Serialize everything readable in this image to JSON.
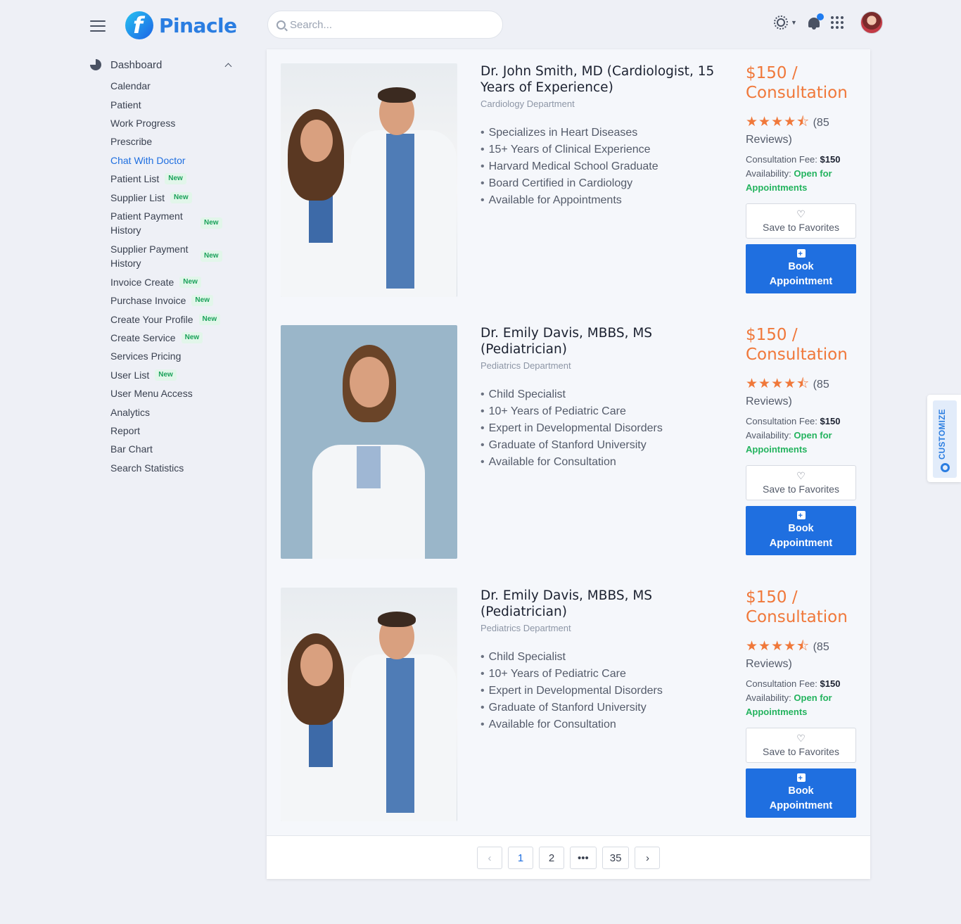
{
  "header": {
    "brand": "Pinacle",
    "search_placeholder": "Search...",
    "icons": [
      "menu-icon",
      "sun-icon",
      "bell-icon",
      "apps-grid-icon",
      "avatar"
    ]
  },
  "sidebar": {
    "section": "Dashboard",
    "items": [
      {
        "label": "Calendar",
        "badge": ""
      },
      {
        "label": "Patient",
        "badge": ""
      },
      {
        "label": "Work Progress",
        "badge": ""
      },
      {
        "label": "Prescribe",
        "badge": ""
      },
      {
        "label": "Chat With Doctor",
        "badge": "",
        "active": true
      },
      {
        "label": "Patient List",
        "badge": "New"
      },
      {
        "label": "Supplier List",
        "badge": "New"
      },
      {
        "label": "Patient Payment History",
        "badge": "New"
      },
      {
        "label": "Supplier Payment History",
        "badge": "New"
      },
      {
        "label": "Invoice Create",
        "badge": "New"
      },
      {
        "label": "Purchase Invoice",
        "badge": "New"
      },
      {
        "label": "Create Your Profile",
        "badge": "New"
      },
      {
        "label": "Create Service",
        "badge": "New"
      },
      {
        "label": "Services Pricing",
        "badge": ""
      },
      {
        "label": "User List",
        "badge": "New"
      },
      {
        "label": "User Menu Access",
        "badge": ""
      },
      {
        "label": "Analytics",
        "badge": ""
      },
      {
        "label": "Report",
        "badge": ""
      },
      {
        "label": "Bar Chart",
        "badge": ""
      },
      {
        "label": "Search Statistics",
        "badge": ""
      }
    ]
  },
  "doctors": [
    {
      "name": "Dr. John Smith, MD (Cardiologist, 15 Years of Experience)",
      "department": "Cardiology Department",
      "highlights": [
        "Specializes in Heart Diseases",
        "15+ Years of Clinical Experience",
        "Harvard Medical School Graduate",
        "Board Certified in Cardiology",
        "Available for Appointments"
      ],
      "price": "$150 / Consultation",
      "rating": 4.5,
      "stars": "★★★★⯪",
      "reviews": "(85 Reviews)",
      "fee_label": "Consultation Fee:",
      "fee_value": "$150",
      "availability_label": "Availability:",
      "availability_value": "Open for Appointments",
      "favorite_label": "Save to Favorites",
      "book_label": "Book Appointment",
      "photo": "two-doctors"
    },
    {
      "name": "Dr. Emily Davis, MBBS, MS (Pediatrician)",
      "department": "Pediatrics Department",
      "highlights": [
        "Child Specialist",
        "10+ Years of Pediatric Care",
        "Expert in Developmental Disorders",
        "Graduate of Stanford University",
        "Available for Consultation"
      ],
      "price": "$150 / Consultation",
      "rating": 4.5,
      "stars": "★★★★⯪",
      "reviews": "(85 Reviews)",
      "fee_label": "Consultation Fee:",
      "fee_value": "$150",
      "availability_label": "Availability:",
      "availability_value": "Open for Appointments",
      "favorite_label": "Save to Favorites",
      "book_label": "Book Appointment",
      "photo": "single-doctor"
    },
    {
      "name": "Dr. Emily Davis, MBBS, MS (Pediatrician)",
      "department": "Pediatrics Department",
      "highlights": [
        "Child Specialist",
        "10+ Years of Pediatric Care",
        "Expert in Developmental Disorders",
        "Graduate of Stanford University",
        "Available for Consultation"
      ],
      "price": "$150 / Consultation",
      "rating": 4.5,
      "stars": "★★★★⯪",
      "reviews": "(85 Reviews)",
      "fee_label": "Consultation Fee:",
      "fee_value": "$150",
      "availability_label": "Availability:",
      "availability_value": "Open for Appointments",
      "favorite_label": "Save to Favorites",
      "book_label": "Book Appointment",
      "photo": "two-doctors"
    }
  ],
  "pagination": {
    "prev": "‹",
    "pages": [
      "1",
      "2",
      "•••",
      "35"
    ],
    "current": "1",
    "next": "›"
  },
  "customize_tab": "CUSTOMIZE",
  "colors": {
    "accent": "#1f6fe0",
    "price": "#f0783a",
    "available": "#23b35e",
    "badge": "#1aa25a"
  }
}
